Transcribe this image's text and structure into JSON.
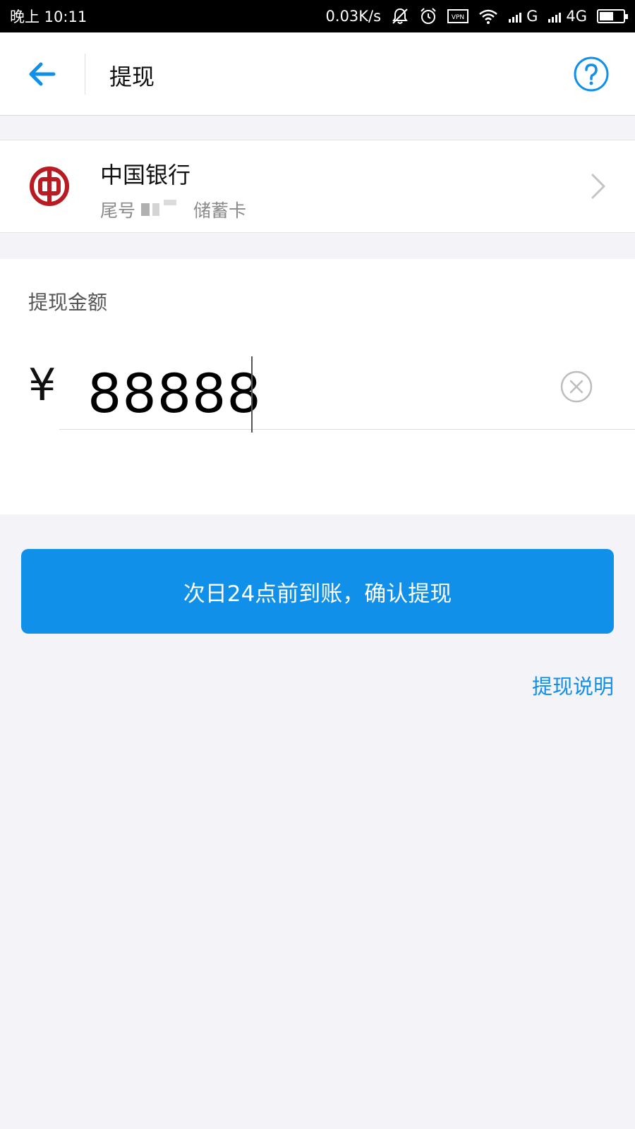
{
  "status_bar": {
    "time": "晚上 10:11",
    "net_speed": "0.03K/s",
    "signal1": "G",
    "signal2": "4G",
    "icons": [
      "bell-off-icon",
      "alarm-icon",
      "vpn-icon",
      "wifi-icon",
      "signal-icon",
      "signal-icon",
      "battery-icon"
    ],
    "battery_level": 0.6
  },
  "header": {
    "title": "提现",
    "back_icon": "back-arrow-icon",
    "help_icon": "question-circle-icon",
    "accent_color": "#1190ea"
  },
  "bank_card": {
    "name": "中国银行",
    "tail_label": "尾号",
    "card_type": "储蓄卡",
    "logo_icon": "bank-of-china-logo",
    "logo_color": "#b81c22"
  },
  "amount": {
    "label": "提现金额",
    "currency_symbol": "¥",
    "value": "88888",
    "clear_icon": "clear-circle-icon"
  },
  "confirm_button": {
    "label": "次日24点前到账，确认提现",
    "color": "#1190ea"
  },
  "help_link": {
    "label": "提现说明"
  }
}
